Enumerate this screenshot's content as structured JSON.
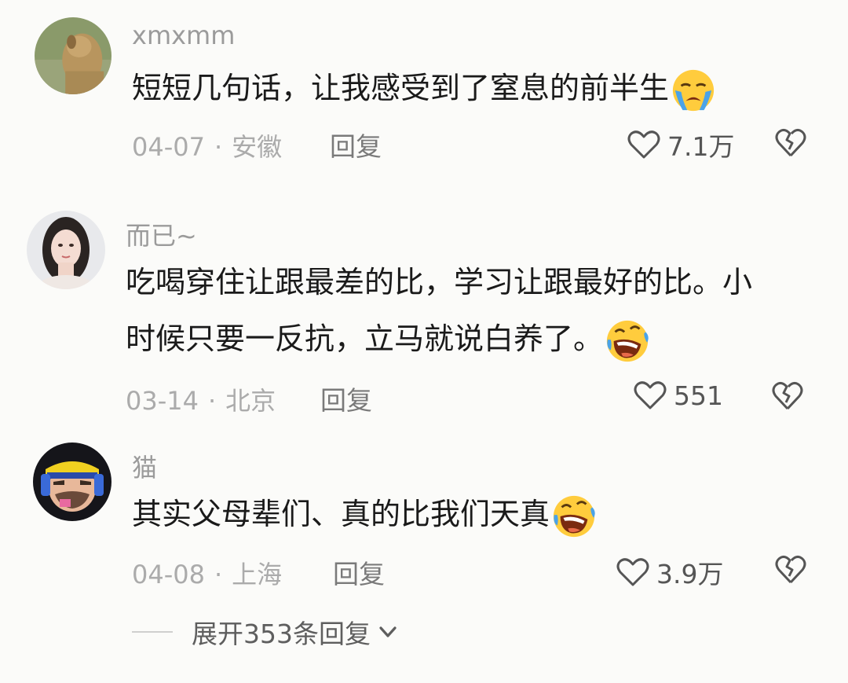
{
  "comments": [
    {
      "username": "xmxmm",
      "text_lines": [
        "短短几句话，让我感受到了窒息的前半生"
      ],
      "emoji": "loudly-crying-face",
      "date": "04-07",
      "location": "安徽",
      "reply_label": "回复",
      "likes": "7.1万"
    },
    {
      "username": "而已~",
      "text_lines": [
        "吃喝穿住让跟最差的比，学习让跟最好的比。小",
        "时候只要一反抗，立马就说白养了。"
      ],
      "emoji": "rolling-on-floor-laughing-face",
      "date": "03-14",
      "location": "北京",
      "reply_label": "回复",
      "likes": "551"
    },
    {
      "username": "猫",
      "text_lines": [
        "其实父母辈们、真的比我们天真"
      ],
      "emoji": "rolling-on-floor-laughing-face",
      "date": "04-08",
      "location": "上海",
      "reply_label": "回复",
      "likes": "3.9万"
    }
  ],
  "expand_replies": {
    "label": "展开353条回复",
    "icon": "chevron-down-icon"
  },
  "colors": {
    "background": "#fbfbf9",
    "username": "#9b9b9b",
    "meta": "#ababab"
  }
}
